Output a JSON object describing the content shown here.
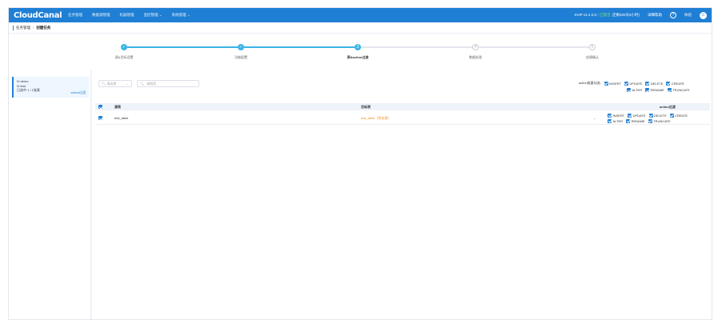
{
  "header": {
    "logo": "CloudCanal",
    "nav": [
      "任务管理",
      "数据源管理",
      "机器管理",
      "监控管理 ⌄",
      "系统管理 ⌄"
    ],
    "version": "SVIP v2.4.0.0",
    "license_status": "( 已激活,",
    "license_remaining": "还剩320天9小时)",
    "help_doc": "详细帮助",
    "help_icon": "?",
    "user": "体验",
    "avatar_letter": "☺"
  },
  "breadcrumb": {
    "root": "任务管理",
    "sep": "/",
    "current": "创建任务"
  },
  "steps": [
    {
      "label": "源&目标设置",
      "state": "done",
      "mark": "✓"
    },
    {
      "label": "功能配置",
      "state": "done",
      "mark": "✓"
    },
    {
      "label": "表&action过滤",
      "state": "active",
      "mark": "3"
    },
    {
      "label": "数据处理",
      "state": "todo",
      "mark": "4"
    },
    {
      "label": "创建确认",
      "state": "todo",
      "mark": "5"
    }
  ],
  "left": {
    "db_source": "demo",
    "db_target": "test",
    "selected_count": "已选中 1 / 1张表",
    "action_filter_link": "action过滤"
  },
  "toolbar": {
    "select_placeholder": "请选择",
    "search_placeholder": "请搜索"
  },
  "batch": {
    "label": "action批量勾选:",
    "options": [
      "INSERT",
      "UPDATE",
      "DELETE",
      "CREATE",
      "ALTER",
      "RENAME",
      "TRUNCATE"
    ]
  },
  "table": {
    "headers": {
      "source": "源表",
      "target": "目标表",
      "action": "action过滤"
    },
    "rows": [
      {
        "source": "test_table",
        "target": "test_table（同名表）",
        "actions": [
          "INSERT",
          "UPDATE",
          "DELETE",
          "CREATE",
          "ALTER",
          "RENAME",
          "TRUNCATE"
        ]
      }
    ]
  }
}
